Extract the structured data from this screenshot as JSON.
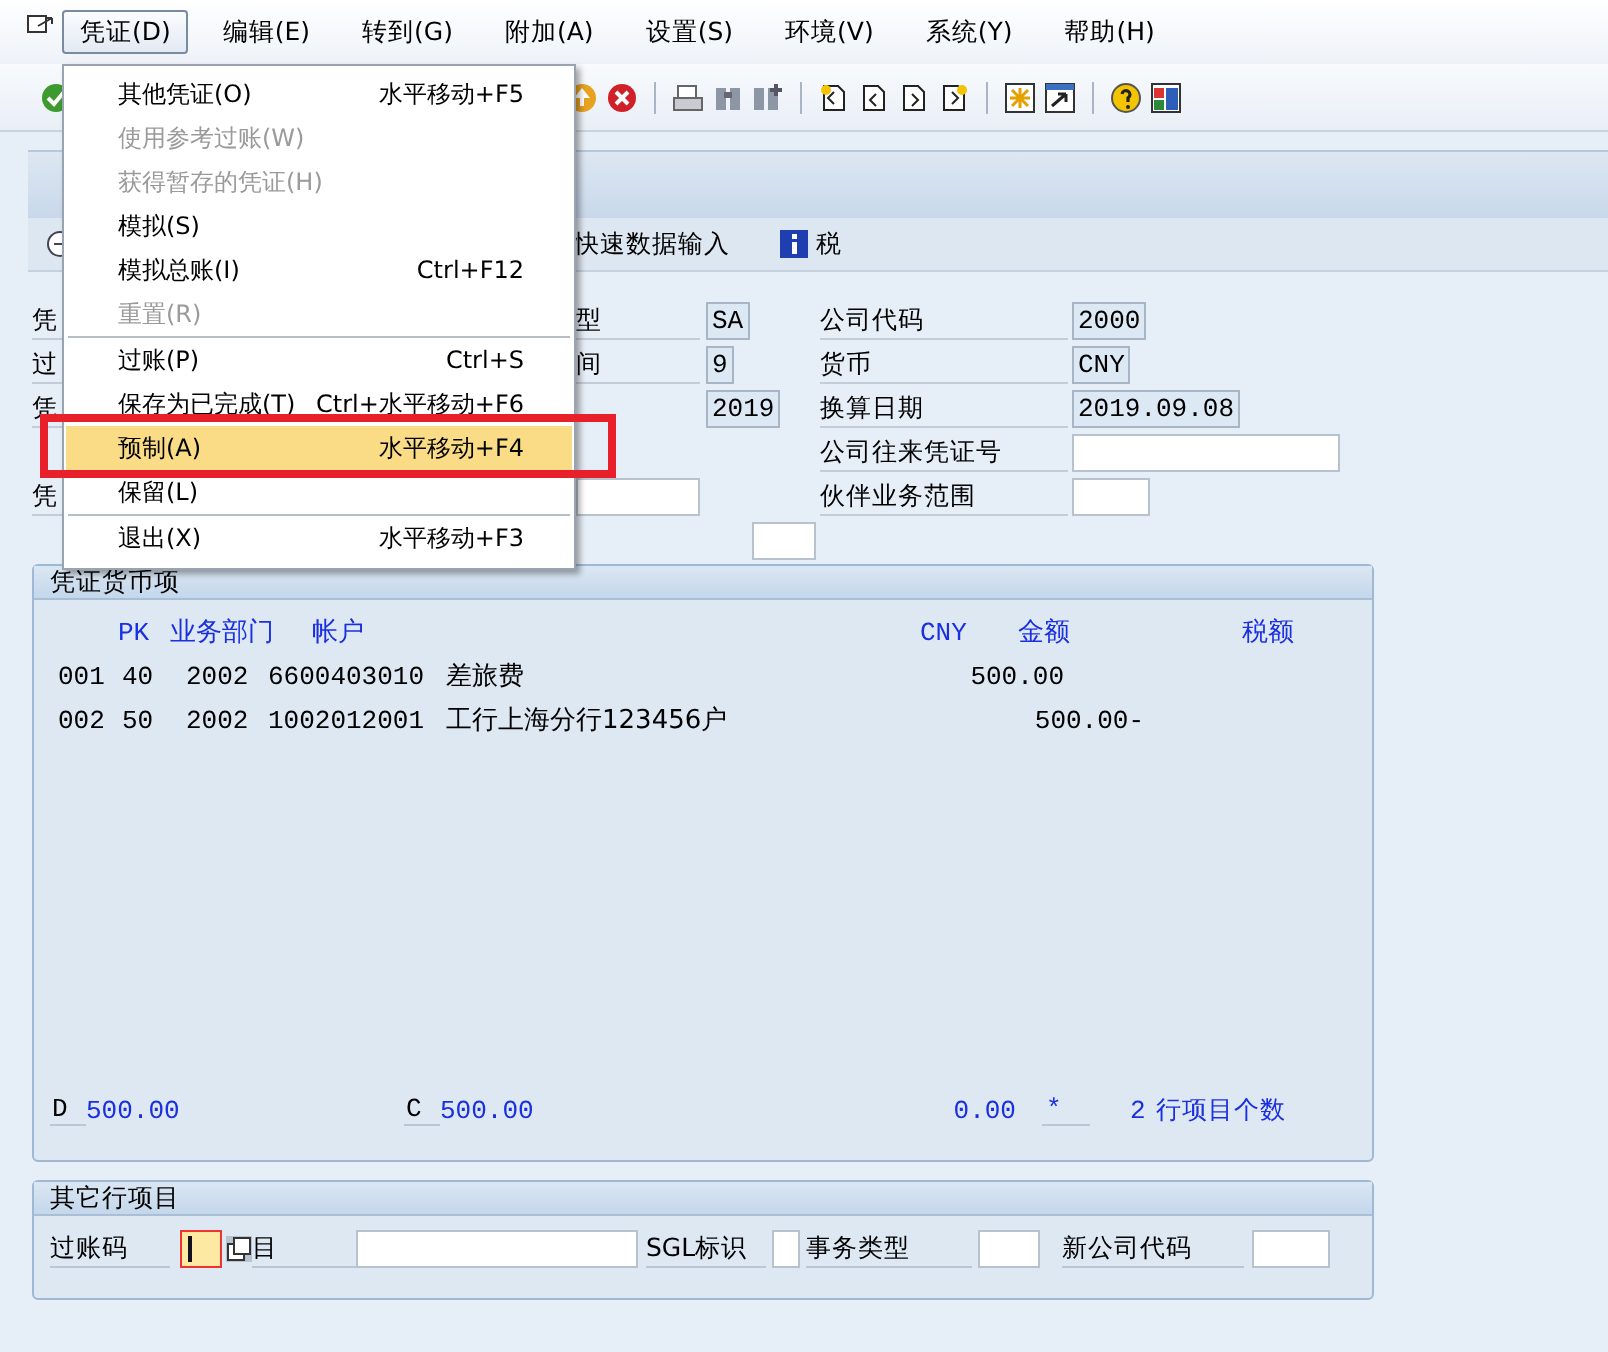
{
  "menubar": [
    {
      "label": "凭证(D)",
      "selected": true
    },
    {
      "label": "编辑(E)",
      "selected": false
    },
    {
      "label": "转到(G)",
      "selected": false
    },
    {
      "label": "附加(A)",
      "selected": false
    },
    {
      "label": "设置(S)",
      "selected": false
    },
    {
      "label": "环境(V)",
      "selected": false
    },
    {
      "label": "系统(Y)",
      "selected": false
    },
    {
      "label": "帮助(H)",
      "selected": false
    }
  ],
  "open_menu": {
    "items": [
      {
        "kind": "item",
        "label": "其他凭证(O)",
        "shortcut": "水平移动+F5",
        "disabled": false,
        "selected": false,
        "annotated": false
      },
      {
        "kind": "item",
        "label": "使用参考过账(W)",
        "disabled": true,
        "selected": false,
        "annotated": false
      },
      {
        "kind": "item",
        "label": "获得暂存的凭证(H)",
        "disabled": true,
        "selected": false,
        "annotated": false
      },
      {
        "kind": "item",
        "label": "模拟(S)",
        "disabled": false,
        "selected": false,
        "annotated": false
      },
      {
        "kind": "item",
        "label": "模拟总账(I)",
        "shortcut": "Ctrl+F12",
        "disabled": false,
        "selected": false,
        "annotated": false
      },
      {
        "kind": "item",
        "label": "重置(R)",
        "disabled": true,
        "selected": false,
        "annotated": false
      },
      {
        "kind": "separator"
      },
      {
        "kind": "item",
        "label": "过账(P)",
        "shortcut": "Ctrl+S",
        "disabled": false,
        "selected": false,
        "annotated": false
      },
      {
        "kind": "item",
        "label": "保存为已完成(T)",
        "shortcut": "Ctrl+水平移动+F6",
        "disabled": false,
        "selected": false,
        "annotated": false
      },
      {
        "kind": "item",
        "label": "预制(A)",
        "shortcut": "水平移动+F4",
        "disabled": false,
        "selected": true,
        "annotated": true
      },
      {
        "kind": "item",
        "label": "保留(L)",
        "disabled": false,
        "selected": false,
        "annotated": false
      },
      {
        "kind": "separator"
      },
      {
        "kind": "item",
        "label": "退出(X)",
        "shortcut": "水平移动+F3",
        "disabled": false,
        "selected": false,
        "annotated": false
      }
    ]
  },
  "app_toolbar": [
    {
      "label": "快速数据输入"
    },
    {
      "label": "税"
    }
  ],
  "header": {
    "rows": [
      {
        "left_label": "凭",
        "label": "型",
        "value": "SA",
        "right_label": "公司代码",
        "right_value": "2000"
      },
      {
        "left_label": "过",
        "label": "间",
        "value": "9",
        "right_label": "货币",
        "right_value": "CNY"
      },
      {
        "left_label": "凭",
        "value": "2019",
        "right_label": "换算日期",
        "right_value": "2019.09.08"
      },
      {
        "right_label": "公司往来凭证号"
      },
      {
        "left_label": "凭",
        "right_label": "伙伴业务范围"
      }
    ]
  },
  "items_panel": {
    "title": "凭证货币项",
    "columns": [
      "PK",
      "业务部门",
      "帐户",
      "CNY",
      "金额",
      "税额"
    ],
    "rows": [
      {
        "line": "001",
        "pk": "40",
        "business_area": "2002",
        "account": "6600403010",
        "account_text": "差旅费",
        "debit": "500.00"
      },
      {
        "line": "002",
        "pk": "50",
        "business_area": "2002",
        "account": "1002012001",
        "account_text": "工行上海分行123456户",
        "credit": "500.00-"
      }
    ],
    "footer": {
      "debit_label": "D",
      "debit": "500.00",
      "credit_label": "C",
      "credit": "500.00",
      "balance": "0.00",
      "balance_flag": "*",
      "line_count": "2",
      "line_count_label": "行项目个数"
    }
  },
  "other_panel": {
    "title": "其它行项目",
    "posting_key_label": "过账码",
    "account_label": "目",
    "sgl_label": "SGL标识",
    "transaction_type_label": "事务类型",
    "new_company_label": "新公司代码"
  }
}
